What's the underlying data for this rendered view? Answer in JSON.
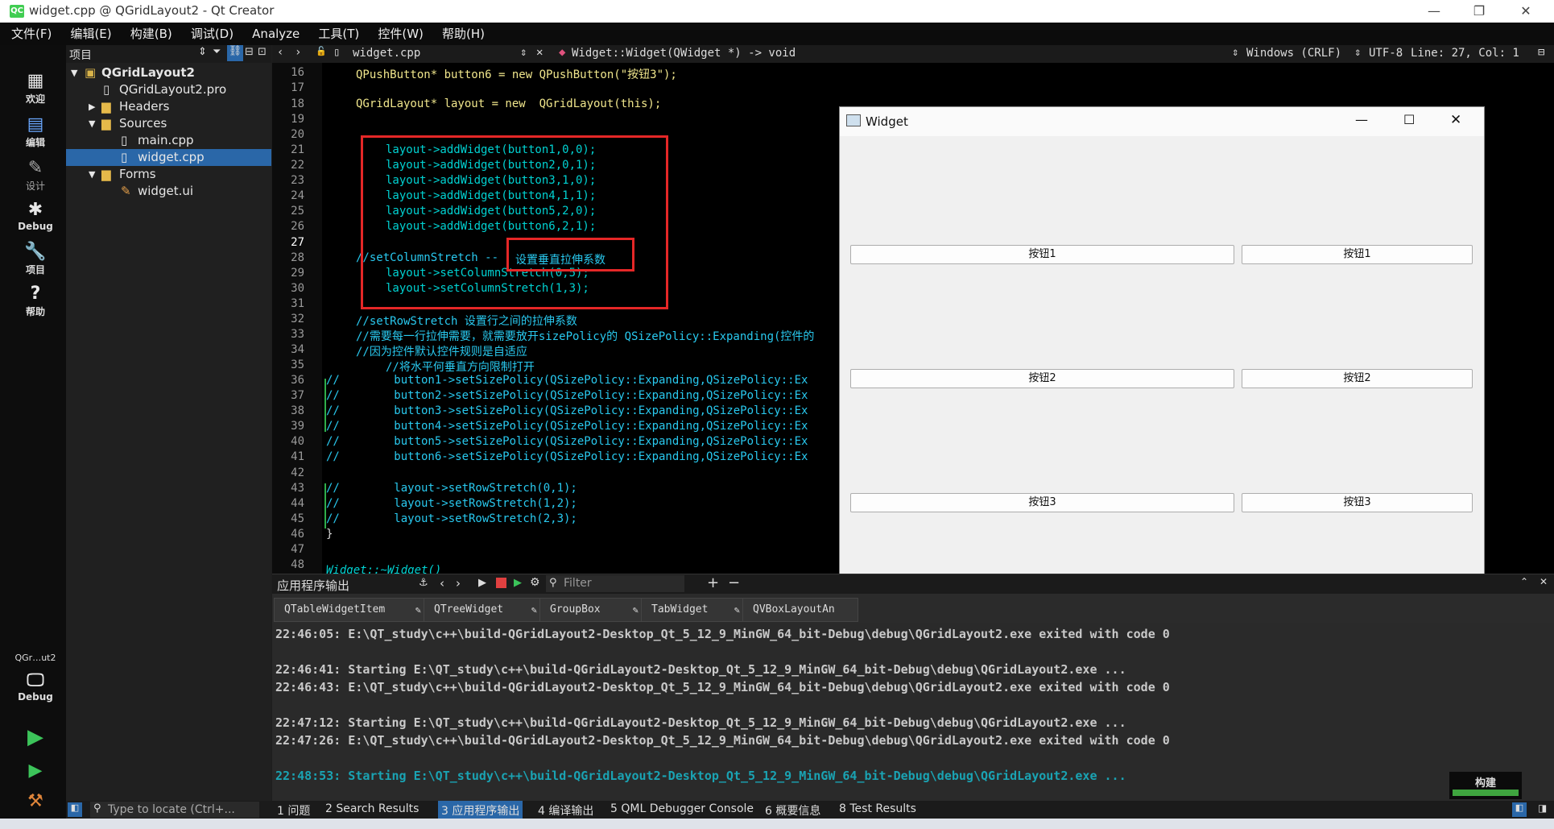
{
  "window": {
    "title": "widget.cpp @ QGridLayout2 - Qt Creator",
    "logo": "QC"
  },
  "menu": [
    "文件(F)",
    "编辑(E)",
    "构建(B)",
    "调试(D)",
    "Analyze",
    "工具(T)",
    "控件(W)",
    "帮助(H)"
  ],
  "modes": [
    {
      "label": "欢迎",
      "icon": "grid-icon"
    },
    {
      "label": "编辑",
      "icon": "edit-icon"
    },
    {
      "label": "设计",
      "icon": "pen-icon"
    },
    {
      "label": "Debug",
      "icon": "bug-icon"
    },
    {
      "label": "项目",
      "icon": "wrench-icon"
    },
    {
      "label": "帮助",
      "icon": "help-icon"
    }
  ],
  "kit": {
    "project": "QGr…ut2",
    "config": "Debug"
  },
  "project_pane": {
    "title": "项目",
    "tree": [
      {
        "label": "QGridLayout2",
        "level": 0,
        "type": "project"
      },
      {
        "label": "QGridLayout2.pro",
        "level": 1,
        "type": "pro"
      },
      {
        "label": "Headers",
        "level": 1,
        "type": "folder"
      },
      {
        "label": "Sources",
        "level": 1,
        "type": "folder"
      },
      {
        "label": "main.cpp",
        "level": 2,
        "type": "cpp"
      },
      {
        "label": "widget.cpp",
        "level": 2,
        "type": "cpp",
        "selected": true
      },
      {
        "label": "Forms",
        "level": 1,
        "type": "folder"
      },
      {
        "label": "widget.ui",
        "level": 2,
        "type": "ui"
      }
    ]
  },
  "editor": {
    "file": "widget.cpp",
    "symbol": "Widget::Widget(QWidget *) -> void",
    "line_ending": "Windows (CRLF)",
    "encoding": "UTF-8",
    "position": "Line: 27, Col: 1",
    "line_numbers": [
      "16",
      "17",
      "18",
      "19",
      "20",
      "21",
      "22",
      "23",
      "24",
      "25",
      "26",
      "27",
      "28",
      "29",
      "30",
      "31",
      "32",
      "33",
      "34",
      "35",
      "36",
      "37",
      "38",
      "39",
      "40",
      "41",
      "42",
      "43",
      "44",
      "45",
      "46",
      "47",
      "48"
    ],
    "code": {
      "l16": "QPushButton* button6 = new QPushButton(\"按钮3\");",
      "l18": "QGridLayout* layout = new  QGridLayout(this);",
      "l21": "layout->addWidget(button1,0,0);",
      "l22": "layout->addWidget(button2,0,1);",
      "l23": "layout->addWidget(button3,1,0);",
      "l24": "layout->addWidget(button4,1,1);",
      "l25": "layout->addWidget(button5,2,0);",
      "l26": "layout->addWidget(button6,2,1);",
      "l28a": "//setColumnStretch -- ",
      "l28b": "设置垂直拉伸系数",
      "l29": "layout->setColumnStretch(0,5);",
      "l30": "layout->setColumnStretch(1,3);",
      "l32": "//setRowStretch 设置行之间的拉伸系数",
      "l33": "//需要每一行拉伸需要，就需要放开sizePolicy的 QSizePolicy::Expanding(控件的",
      "l34": "//因为控件默认控件规则是自适应",
      "l35": "//将水平何垂直方向限制打开",
      "l36": "//        button1->setSizePolicy(QSizePolicy::Expanding,QSizePolicy::Ex",
      "l37": "//        button2->setSizePolicy(QSizePolicy::Expanding,QSizePolicy::Ex",
      "l38": "//        button3->setSizePolicy(QSizePolicy::Expanding,QSizePolicy::Ex",
      "l39": "//        button4->setSizePolicy(QSizePolicy::Expanding,QSizePolicy::Ex",
      "l40": "//        button5->setSizePolicy(QSizePolicy::Expanding,QSizePolicy::Ex",
      "l41": "//        button6->setSizePolicy(QSizePolicy::Expanding,QSizePolicy::Ex",
      "l43": "//        layout->setRowStretch(0,1);",
      "l44": "//        layout->setRowStretch(1,2);",
      "l45": "//        layout->setRowStretch(2,3);",
      "l46": "}",
      "l48": "Widget::~Widget()"
    }
  },
  "widget_window": {
    "title": "Widget",
    "buttons": [
      {
        "left": "按钮1",
        "right": "按钮1"
      },
      {
        "left": "按钮2",
        "right": "按钮2"
      },
      {
        "left": "按钮3",
        "right": "按钮3"
      }
    ]
  },
  "output": {
    "title": "应用程序输出",
    "filter_placeholder": "Filter",
    "tabs": [
      "QTableWidgetItem",
      "QTreeWidget",
      "GroupBox",
      "TabWidget",
      "QVBoxLayoutAn"
    ],
    "lines": [
      "22:46:05: E:\\QT_study\\c++\\build-QGridLayout2-Desktop_Qt_5_12_9_MinGW_64_bit-Debug\\debug\\QGridLayout2.exe exited with code 0",
      "",
      "22:46:41: Starting E:\\QT_study\\c++\\build-QGridLayout2-Desktop_Qt_5_12_9_MinGW_64_bit-Debug\\debug\\QGridLayout2.exe ...",
      "22:46:43: E:\\QT_study\\c++\\build-QGridLayout2-Desktop_Qt_5_12_9_MinGW_64_bit-Debug\\debug\\QGridLayout2.exe exited with code 0",
      "",
      "22:47:12: Starting E:\\QT_study\\c++\\build-QGridLayout2-Desktop_Qt_5_12_9_MinGW_64_bit-Debug\\debug\\QGridLayout2.exe ...",
      "22:47:26: E:\\QT_study\\c++\\build-QGridLayout2-Desktop_Qt_5_12_9_MinGW_64_bit-Debug\\debug\\QGridLayout2.exe exited with code 0",
      "",
      "22:48:53: Starting E:\\QT_study\\c++\\build-QGridLayout2-Desktop_Qt_5_12_9_MinGW_64_bit-Debug\\debug\\QGridLayout2.exe ..."
    ]
  },
  "build_badge": "构建",
  "status": {
    "locate_placeholder": "Type to locate (Ctrl+...",
    "tabs": [
      "1 问题",
      "2 Search Results",
      "3 应用程序输出",
      "4 编译输出",
      "5 QML Debugger Console",
      "6 概要信息",
      "8 Test Results"
    ]
  },
  "colors": {
    "accent": "#2a67a8",
    "highlight_box": "#e52727",
    "comment": "#29c9ef",
    "keyword": "#f0e68c",
    "number": "#ff6fe2"
  }
}
